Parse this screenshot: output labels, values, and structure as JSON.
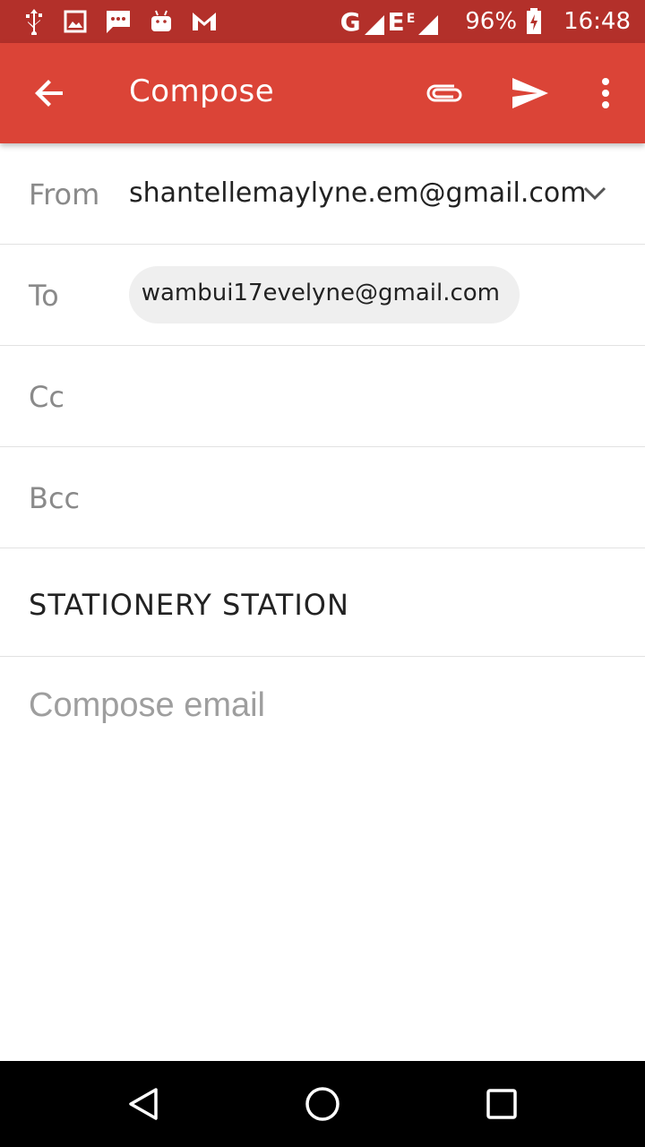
{
  "status_bar": {
    "network_type_1": "G",
    "network_type_2": "E",
    "network_type_2_sup": "E",
    "battery": "96%",
    "time": "16:48",
    "icons": [
      "usb-icon",
      "image-icon",
      "message-icon",
      "android-icon",
      "gmail-icon",
      "signal-icon",
      "battery-charging-icon"
    ]
  },
  "app_bar": {
    "title": "Compose",
    "back_icon": "arrow-back-icon",
    "attach_icon": "attachment-icon",
    "send_icon": "send-icon",
    "more_icon": "more-vert-icon"
  },
  "form": {
    "from_label": "From",
    "from_value": "shantellemaylyne.em@gmail.com",
    "to_label": "To",
    "to_chip": "wambui17evelyne@gmail.com",
    "cc_label": "Cc",
    "bcc_label": "Bcc",
    "subject_value": "STATIONERY STATION",
    "body_placeholder": "Compose email"
  },
  "nav_bar": {
    "back": "nav-back-icon",
    "home": "nav-home-icon",
    "recents": "nav-recents-icon"
  },
  "colors": {
    "status_bar": "#b3302a",
    "app_bar": "#db4437",
    "chip": "#efefef"
  }
}
